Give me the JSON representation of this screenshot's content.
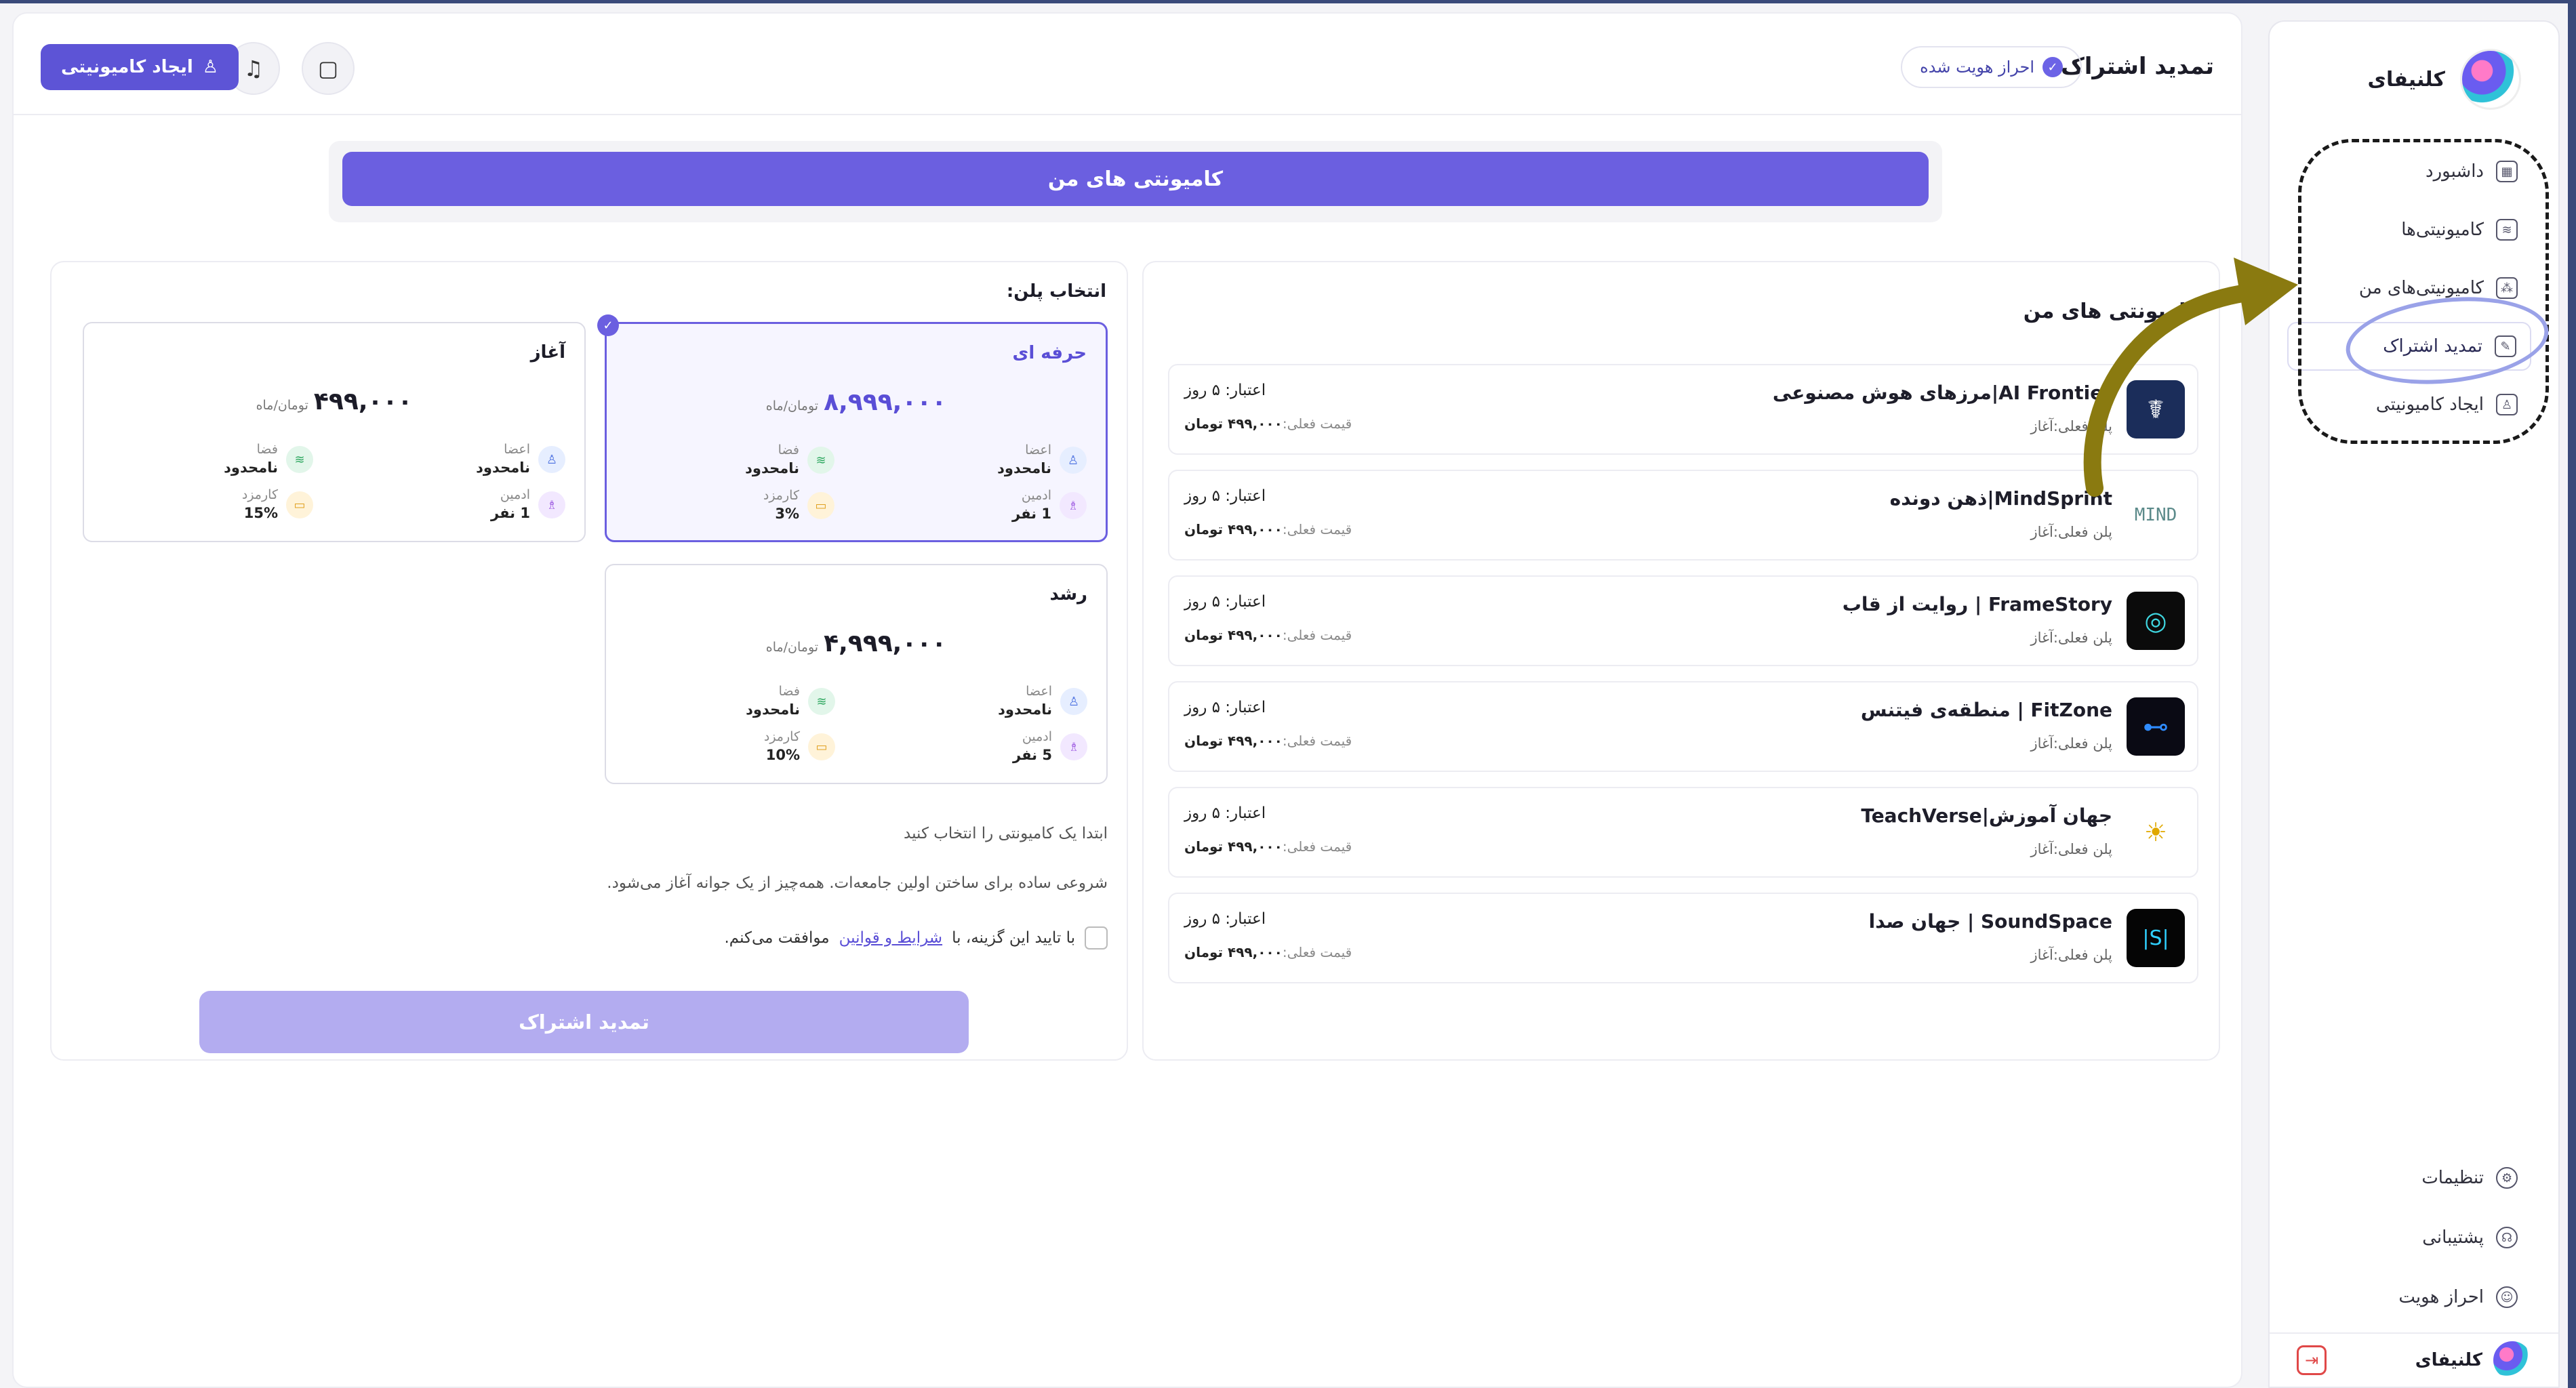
{
  "sidebar": {
    "brand_name": "کلنیفای",
    "items": [
      {
        "label": "داشبورد",
        "icon": "dashboard-icon"
      },
      {
        "label": "کامیونیتی‌ها",
        "icon": "layers-icon"
      },
      {
        "label": "کامیونیتی‌های من",
        "icon": "community-icon"
      },
      {
        "label": "تمدید اشتراک",
        "icon": "edit-icon"
      },
      {
        "label": "ایجاد کامیونیتی",
        "icon": "user-add-icon"
      }
    ],
    "bottom_items": [
      {
        "label": "تنظیمات",
        "icon": "gear-icon"
      },
      {
        "label": "پشتیبانی",
        "icon": "headset-icon"
      },
      {
        "label": "احراز هویت",
        "icon": "user-circle-icon"
      }
    ],
    "footer_brand": "کلنیفای"
  },
  "header": {
    "title": "تمدید اشتراک",
    "verified_label": "احراز هویت شده",
    "create_button": "ایجاد کامیونیتی"
  },
  "banner": {
    "label": "کامیونتی های من"
  },
  "communities": {
    "title": "کامیونتی های من",
    "items": [
      {
        "name": "AI Frontier|مرزهای هوش مصنوعی",
        "plan": "پلن فعلی:آغاز",
        "credit": "اعتبار: ۵ روز",
        "price_label": "قیمت فعلی:",
        "price": "۴۹۹,۰۰۰ تومان",
        "icon_color": "#1b2d5a"
      },
      {
        "name": "MindSprint|ذهن دونده",
        "plan": "پلن فعلی:آغاز",
        "credit": "اعتبار: ۵ روز",
        "price_label": "قیمت فعلی:",
        "price": "۴۹۹,۰۰۰ تومان",
        "icon_color": "#ffffff"
      },
      {
        "name": "FrameStory | روایت از قاب",
        "plan": "پلن فعلی:آغاز",
        "credit": "اعتبار: ۵ روز",
        "price_label": "قیمت فعلی:",
        "price": "۴۹۹,۰۰۰ تومان",
        "icon_color": "#0b0b0b"
      },
      {
        "name": "FitZone | منطقه‌ی فیتنس",
        "plan": "پلن فعلی:آغاز",
        "credit": "اعتبار: ۵ روز",
        "price_label": "قیمت فعلی:",
        "price": "۴۹۹,۰۰۰ تومان",
        "icon_color": "#0a0a14"
      },
      {
        "name": "جهان آموزش|TeachVerse",
        "plan": "پلن فعلی:آغاز",
        "credit": "اعتبار: ۵ روز",
        "price_label": "قیمت فعلی:",
        "price": "۴۹۹,۰۰۰ تومان",
        "icon_color": "#ffffff"
      },
      {
        "name": "SoundSpace | جهان صدا",
        "plan": "پلن فعلی:آغاز",
        "credit": "اعتبار: ۵ روز",
        "price_label": "قیمت فعلی:",
        "price": "۴۹۹,۰۰۰ تومان",
        "icon_color": "#050505"
      }
    ]
  },
  "plans": {
    "title": "انتخاب پلن:",
    "unit": "تومان/ماه",
    "items": [
      {
        "name": "حرفه ای",
        "price": "۸,۹۹۹,۰۰۰",
        "selected": true,
        "members_label": "اعضا",
        "members": "نامحدود",
        "space_label": "فضا",
        "space": "نامحدود",
        "admin_label": "ادمین",
        "admin": "1 نفر",
        "fee_label": "کارمزد",
        "fee": "3%"
      },
      {
        "name": "آغاز",
        "price": "۴۹۹,۰۰۰",
        "selected": false,
        "members_label": "اعضا",
        "members": "نامحدود",
        "space_label": "فضا",
        "space": "نامحدود",
        "admin_label": "ادمین",
        "admin": "1 نفر",
        "fee_label": "کارمزد",
        "fee": "15%"
      },
      {
        "name": "رشد",
        "price": "۴,۹۹۹,۰۰۰",
        "selected": false,
        "members_label": "اعضا",
        "members": "نامحدود",
        "space_label": "فضا",
        "space": "نامحدود",
        "admin_label": "ادمین",
        "admin": "5 نفر",
        "fee_label": "کارمزد",
        "fee": "10%"
      }
    ],
    "note_select": "ابتدا یک کامیونتی را انتخاب کنید",
    "note_desc": "شروعی ساده برای ساختن اولین جامعه‌ات. همه‌چیز از یک جوانه آغاز می‌شود.",
    "terms_prefix": "با تایید این گزینه، با",
    "terms_link": "شرایط و قوانین",
    "terms_suffix": "موافقت می‌کنم.",
    "renew_button": "تمدید اشتراک"
  },
  "colors": {
    "accent": "#6b5fe0",
    "accent_light": "#b3acf0",
    "annotation_arrow": "#8a7a10",
    "annotation_circle": "#9aa2e8"
  }
}
